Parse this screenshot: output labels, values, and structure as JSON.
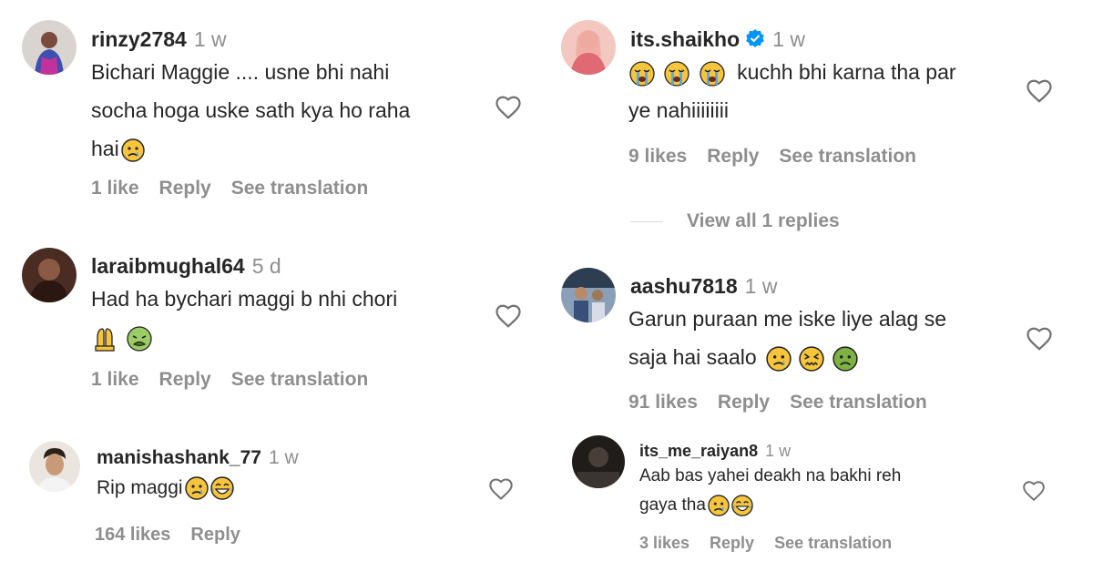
{
  "comments_left": [
    {
      "username": "rinzy2784",
      "time": "1 w",
      "text_lines": [
        "Bichari Maggie .... usne bhi nahi",
        "socha hoga uske sath kya ho raha",
        "hai"
      ],
      "likes": "1 like",
      "reply": "Reply",
      "see_translation": "See translation"
    },
    {
      "username": "laraibmughal64",
      "time": "5 d",
      "text_lines": [
        "Had ha bychari maggi b nhi chori"
      ],
      "likes": "1 like",
      "reply": "Reply",
      "see_translation": "See translation"
    },
    {
      "username": "manishashank_77",
      "time": "1 w",
      "text_lines": [
        "Rip maggi"
      ],
      "likes": "164 likes",
      "reply": "Reply"
    }
  ],
  "comments_right": [
    {
      "username": "its.shaikho",
      "time": "1 w",
      "verified": true,
      "text_lines": [
        "kuchh bhi karna tha par",
        "ye nahiiiiiiii"
      ],
      "likes": "9 likes",
      "reply": "Reply",
      "see_translation": "See translation",
      "view_replies": "View all 1 replies"
    },
    {
      "username": "aashu7818",
      "time": "1 w",
      "text_lines": [
        "Garun puraan me iske liye alag se",
        "saja hai saalo"
      ],
      "likes": "91 likes",
      "reply": "Reply",
      "see_translation": "See translation"
    },
    {
      "username": "its_me_raiyan8",
      "time": "1 w",
      "text_lines": [
        "Aab bas yahei deakh na bakhi reh",
        "gaya tha"
      ],
      "likes": "3 likes",
      "reply": "Reply",
      "see_translation": "See translation"
    }
  ],
  "colors": {
    "text": "#262626",
    "secondary": "#8e8e8e",
    "verified_blue": "#0095f6",
    "emoji_yellow": "#f7c53c",
    "emoji_green": "#7cb342"
  }
}
